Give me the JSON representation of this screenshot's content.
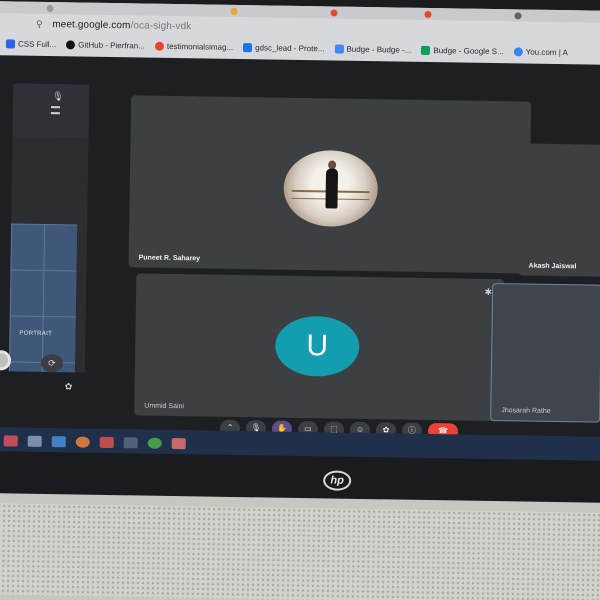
{
  "browser": {
    "tabs": [
      {
        "label": "",
        "color": "#9a9a9a"
      },
      {
        "label": "",
        "color": "#e8a33a"
      },
      {
        "label": "",
        "color": "#ea4335"
      },
      {
        "label": "",
        "color": "#ea4335"
      },
      {
        "label": "",
        "color": "#5f6368"
      }
    ],
    "url_host": "meet.google.com",
    "url_path": "/oca-sigh-vdk",
    "bookmarks": [
      {
        "label": "CSS Full...",
        "color": "#2965f1"
      },
      {
        "label": "GitHub - Pierfran...",
        "color": "#111111"
      },
      {
        "label": "testimonialsimag...",
        "color": "#ea4335"
      },
      {
        "label": "gdsc_lead - Prote...",
        "color": "#1a73e8"
      },
      {
        "label": "Budge - Budge -...",
        "color": "#4285f4"
      },
      {
        "label": "Budge - Google S...",
        "color": "#0f9d58"
      },
      {
        "label": "You.com | A",
        "color": "#3b82f6"
      }
    ]
  },
  "camera_panel": {
    "mode_label": "PORTRAIT"
  },
  "meeting": {
    "participants": [
      {
        "name": "Puneet R. Saharey"
      },
      {
        "name": "Akash Jaiswal"
      },
      {
        "name": "Ummid Saini",
        "initial": "U",
        "color": "#129eaf"
      },
      {
        "name": "Jhosarah Rathe"
      }
    ],
    "controls": [
      {
        "id": "more",
        "glyph": "⌃"
      },
      {
        "id": "mic",
        "glyph": "🎙"
      },
      {
        "id": "hand",
        "glyph": "✋"
      },
      {
        "id": "captions",
        "glyph": "▭"
      },
      {
        "id": "present",
        "glyph": "⬚"
      },
      {
        "id": "emoji",
        "glyph": "☺"
      },
      {
        "id": "activities",
        "glyph": "✿"
      },
      {
        "id": "info",
        "glyph": "ⓘ"
      },
      {
        "id": "leave",
        "glyph": "☎"
      }
    ]
  },
  "laptop": {
    "brand": "hp"
  }
}
